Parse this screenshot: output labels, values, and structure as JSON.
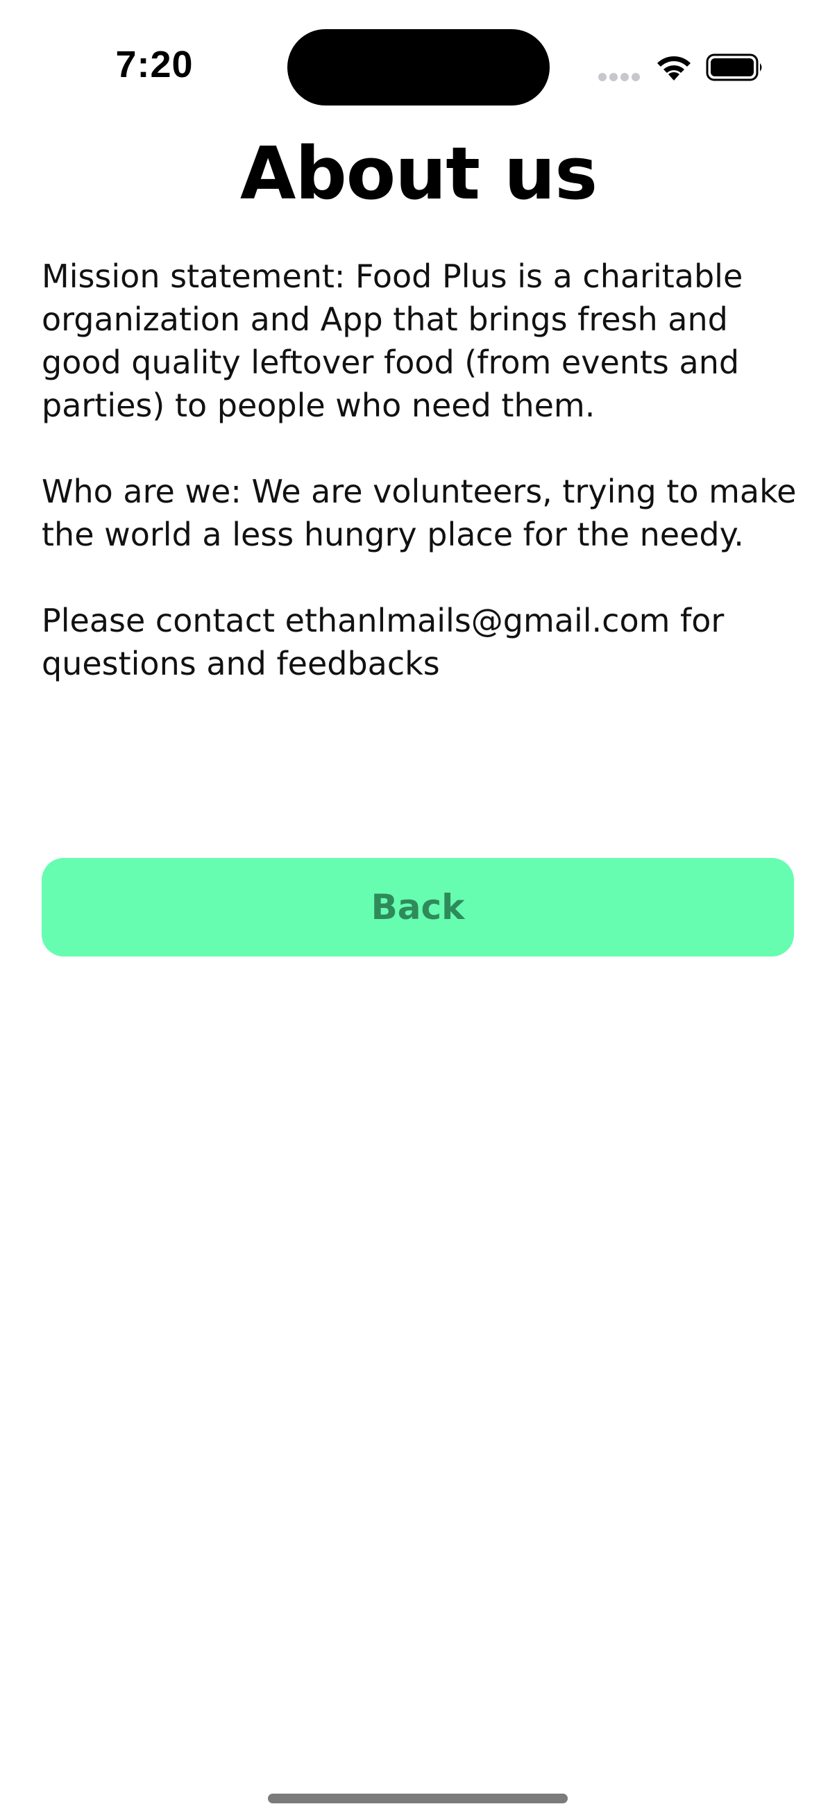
{
  "status_bar": {
    "time": "7:20"
  },
  "page": {
    "title": "About us",
    "paragraphs": [
      "Mission statement: Food Plus is a charitable organization and App that brings fresh and good quality leftover food (from events and parties) to people who need them.",
      "Who are we: We are volunteers, trying to make the world a less hungry place for the needy.",
      "Please contact ethanlmails@gmail.com for questions and feedbacks"
    ]
  },
  "actions": {
    "back_label": "Back"
  },
  "colors": {
    "button_bg": "#66fdb0",
    "button_text": "#2f8a5b"
  },
  "icons": [
    "signal-icon",
    "wifi-icon",
    "battery-icon"
  ]
}
